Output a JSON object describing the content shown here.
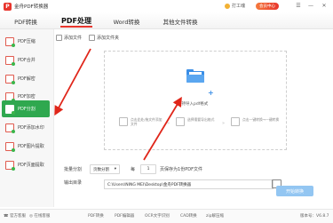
{
  "app": {
    "title": "金舟PDF转换器",
    "user": "打工魂",
    "vip": "会员中心"
  },
  "window_controls": [
    "☰",
    "—",
    "✕"
  ],
  "tabs": [
    {
      "label": "PDF转换"
    },
    {
      "label": "PDF处理"
    },
    {
      "label": "Word转换"
    },
    {
      "label": "其他文件转换"
    }
  ],
  "sidebar": [
    {
      "label": "PDF压缩"
    },
    {
      "label": "PDF合并"
    },
    {
      "label": "PDF解密"
    },
    {
      "label": "PDF加密"
    },
    {
      "label": "PDF分割"
    },
    {
      "label": "PDF添加水印"
    },
    {
      "label": "PDF图片提取"
    },
    {
      "label": "PDF页面提取"
    }
  ],
  "toolbar": {
    "add_file": "添加文件",
    "add_folder": "添加文件夹"
  },
  "dropzone": {
    "hint": "支持导入pdf格式",
    "steps": [
      "点击此处/拖文件添加文件",
      "选择需要导出格式",
      "点击一键转换→一键转换"
    ]
  },
  "settings": {
    "split_label": "批量分割",
    "split_mode": "页数分割",
    "every_label": "每",
    "every_value": "1",
    "every_suffix": "页保存为1份PDF文件",
    "output_label": "输出目录",
    "output_path": "C:\\Users\\NING MEI\\Desktop\\金舟PDF转换器",
    "start_button": "开始转换"
  },
  "statusbar": {
    "phone": "官方客服",
    "chat": "在线客服",
    "links": [
      "PDF转换",
      "PDF编辑器",
      "OCR文字识别",
      "CAD转换",
      "zip解压缩"
    ],
    "version": "版本号：V6.8.7"
  }
}
